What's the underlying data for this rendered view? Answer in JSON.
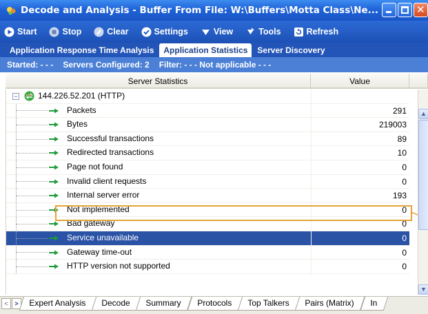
{
  "window": {
    "title": "Decode and Analysis - Buffer From File: W:\\Buffers\\Motta Class\\Ne...",
    "controls": {
      "minimize": "minimize",
      "maximize": "maximize",
      "close": "close"
    }
  },
  "toolbar": {
    "start": "Start",
    "stop": "Stop",
    "clear": "Clear",
    "settings": "Settings",
    "view": "View",
    "tools": "Tools",
    "refresh": "Refresh"
  },
  "tabs": [
    {
      "label": "Application Response Time Analysis",
      "active": false
    },
    {
      "label": "Application Statistics",
      "active": true
    },
    {
      "label": "Server Discovery",
      "active": false
    }
  ],
  "status": {
    "started": "Started:  - - -",
    "servers": "Servers Configured: 2",
    "filter": "Filter: - - - Not applicable - - -"
  },
  "grid": {
    "headers": {
      "name": "Server Statistics",
      "value": "Value"
    },
    "root": {
      "label": "144.226.52.201 (HTTP)",
      "expanded": true
    },
    "rows": [
      {
        "label": "Packets",
        "value": "291"
      },
      {
        "label": "Bytes",
        "value": "219003"
      },
      {
        "label": "Successful transactions",
        "value": "89"
      },
      {
        "label": "Redirected transactions",
        "value": "10"
      },
      {
        "label": "Page not found",
        "value": "0"
      },
      {
        "label": "Invalid client requests",
        "value": "0"
      },
      {
        "label": "Internal server error",
        "value": "193"
      },
      {
        "label": "Not implemented",
        "value": "0"
      },
      {
        "label": "Bad gateway",
        "value": "0"
      },
      {
        "label": "Service unavailable",
        "value": "0"
      },
      {
        "label": "Gateway time-out",
        "value": "0"
      },
      {
        "label": "HTTP version not supported",
        "value": "0"
      }
    ],
    "selected_row": "Service unavailable",
    "highlighted_row": "Internal server error"
  },
  "bottom_tabs": [
    "Expert Analysis",
    "Decode",
    "Summary",
    "Protocols",
    "Top Talkers",
    "Pairs (Matrix)",
    "In"
  ],
  "colors": {
    "titlebar": "#1f63d8",
    "toolbar": "#2c6ad6",
    "selection": "#2a53a6",
    "highlight": "#e4a23a",
    "arrow": "#1f9a3a"
  }
}
